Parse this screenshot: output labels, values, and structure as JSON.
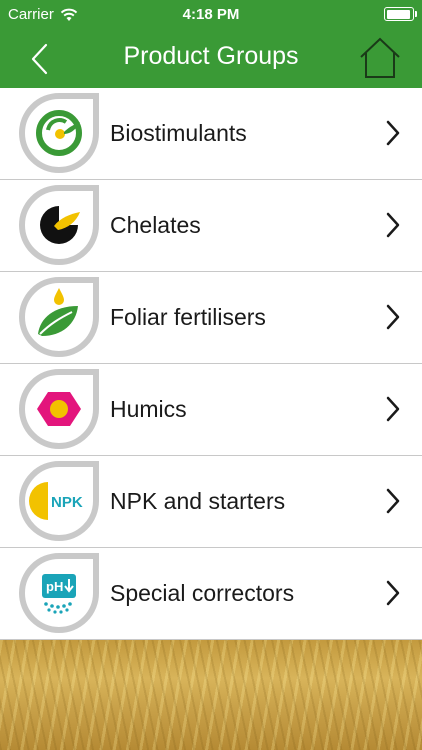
{
  "status_bar": {
    "carrier": "Carrier",
    "time": "4:18 PM",
    "wifi_icon": "wifi-icon",
    "battery_icon": "battery-icon"
  },
  "nav": {
    "title": "Product Groups",
    "back_icon": "chevron-left-icon",
    "home_icon": "home-icon",
    "color": "#3a9a36"
  },
  "groups": [
    {
      "label": "Biostimulants",
      "icon": "biostimulants-icon"
    },
    {
      "label": "Chelates",
      "icon": "chelates-icon"
    },
    {
      "label": "Foliar fertilisers",
      "icon": "foliar-fertilisers-icon"
    },
    {
      "label": "Humics",
      "icon": "humics-icon"
    },
    {
      "label": "NPK and starters",
      "icon": "npk-icon",
      "icon_text": "NPK"
    },
    {
      "label": "Special correctors",
      "icon": "special-correctors-icon",
      "icon_text": "pH"
    }
  ]
}
